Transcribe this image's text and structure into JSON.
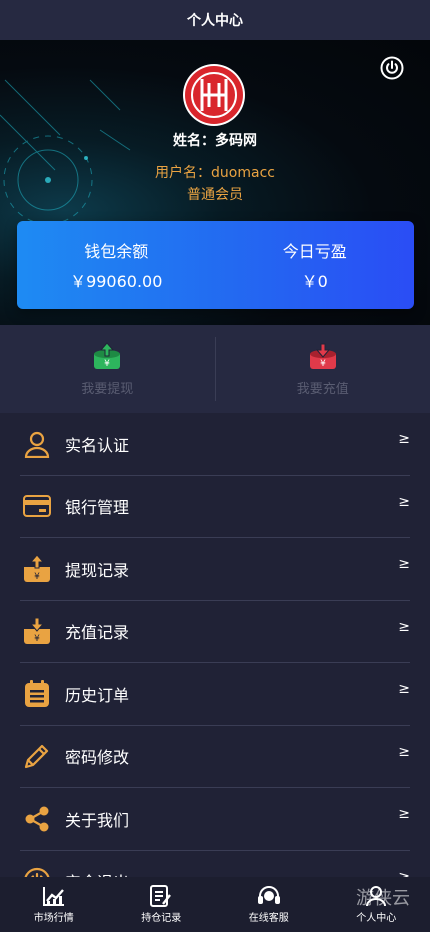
{
  "header": {
    "title": "个人中心"
  },
  "profile": {
    "name": "姓名：多码网",
    "account": "用户名：duomacc",
    "level": "普通会员"
  },
  "balance": {
    "wallet_label": "钱包余额",
    "wallet_value": "￥99060.00",
    "profit_label": "今日亏盈",
    "profit_value": "￥0"
  },
  "actions": [
    {
      "label": "我要提现",
      "icon": "withdraw-icon",
      "color": "#2db55d"
    },
    {
      "label": "我要充值",
      "icon": "deposit-icon",
      "color": "#e03a4a"
    }
  ],
  "menu": {
    "arrow": "≥",
    "items": [
      {
        "label": "实名认证",
        "icon": "user-icon"
      },
      {
        "label": "银行管理",
        "icon": "bank-card-icon"
      },
      {
        "label": "提现记录",
        "icon": "withdraw-record-icon"
      },
      {
        "label": "充值记录",
        "icon": "deposit-record-icon"
      },
      {
        "label": "历史订单",
        "icon": "order-history-icon"
      },
      {
        "label": "密码修改",
        "icon": "pencil-icon"
      },
      {
        "label": "关于我们",
        "icon": "share-icon"
      },
      {
        "label": "安全退出",
        "icon": "power-icon"
      }
    ]
  },
  "tabbar": [
    {
      "label": "市场行情",
      "icon": "chart-icon"
    },
    {
      "label": "持仓记录",
      "icon": "notes-icon"
    },
    {
      "label": "在线客服",
      "icon": "headset-icon"
    },
    {
      "label": "个人中心",
      "icon": "person-icon"
    }
  ],
  "watermark": "游侠云",
  "colors": {
    "accent": "#e9a342",
    "card_start": "#1e8bf3",
    "card_end": "#2a4df5",
    "background": "#202236"
  }
}
